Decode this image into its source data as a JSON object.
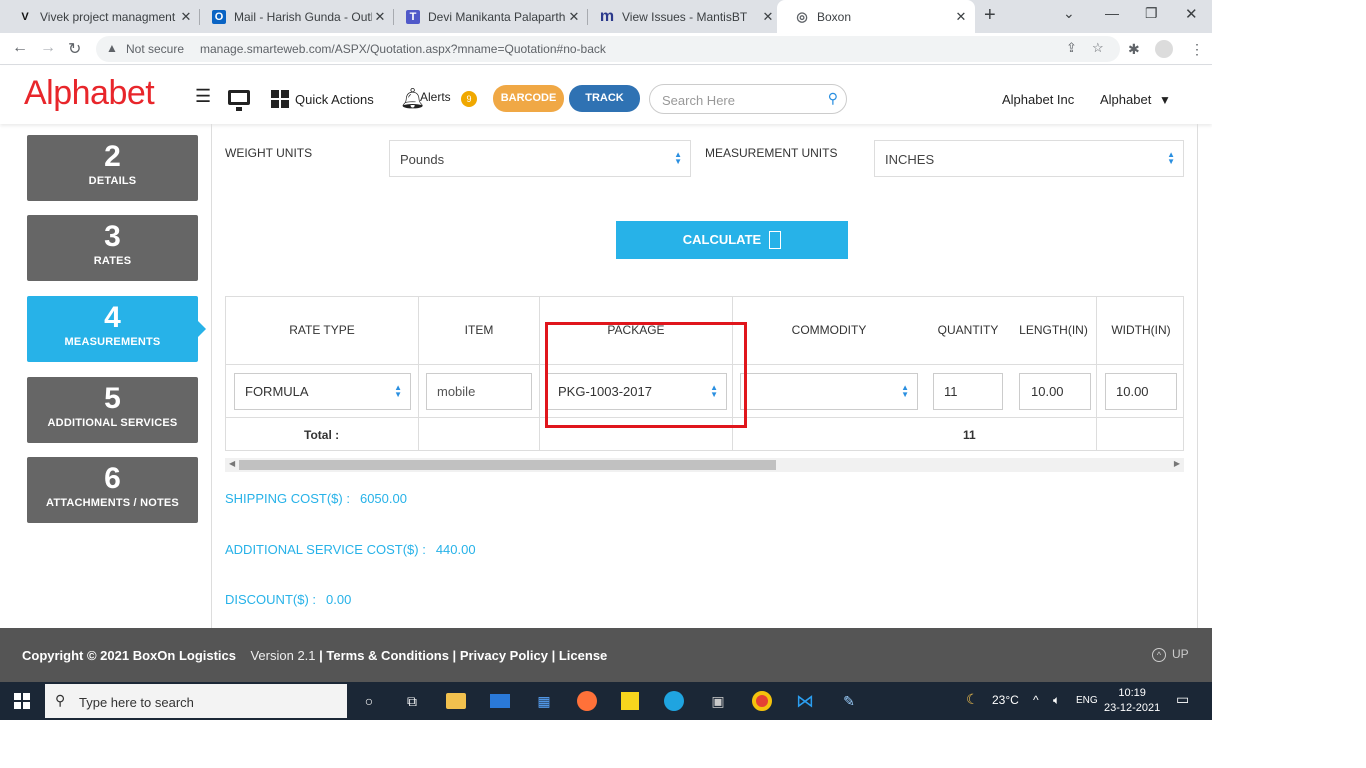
{
  "browser": {
    "tabs": [
      {
        "icon": "V",
        "title": "Vivek project managment",
        "icon_name": "v-favicon-icon"
      },
      {
        "icon": "O",
        "title": "Mail - Harish Gunda - Outlook",
        "icon_name": "outlook-favicon-icon"
      },
      {
        "icon": "T",
        "title": "Devi Manikanta Palaparthi | Microsoft Teams",
        "icon_name": "teams-favicon-icon"
      },
      {
        "icon": "m",
        "title": "View Issues - MantisBT",
        "icon_name": "mantis-favicon-icon"
      },
      {
        "icon": "◎",
        "title": "Boxon",
        "icon_name": "globe-favicon-icon"
      }
    ],
    "new_tab": "+",
    "not_secure": "Not secure",
    "url": "manage.smarteweb.com/ASPX/Quotation.aspx?mname=Quotation#no-back"
  },
  "header": {
    "logo": "Alphabet",
    "quick_actions": "Quick Actions",
    "alerts": "Alerts",
    "alerts_count": "9",
    "barcode": "BARCODE",
    "track": "TRACK",
    "search_placeholder": "Search Here",
    "company": "Alphabet Inc",
    "user": "Alphabet"
  },
  "steps": [
    {
      "num": "2",
      "label": "DETAILS"
    },
    {
      "num": "3",
      "label": "RATES"
    },
    {
      "num": "4",
      "label": "MEASUREMENTS"
    },
    {
      "num": "5",
      "label": "ADDITIONAL SERVICES"
    },
    {
      "num": "6",
      "label": "ATTACHMENTS / NOTES"
    }
  ],
  "form": {
    "weight_units_label": "WEIGHT UNITS",
    "weight_units_value": "Pounds",
    "measurement_units_label": "MEASUREMENT UNITS",
    "measurement_units_value": "INCHES",
    "calculate": "CALCULATE"
  },
  "grid": {
    "headers": [
      "RATE TYPE",
      "ITEM",
      "PACKAGE",
      "COMMODITY",
      "QUANTITY",
      "LENGTH(IN)",
      "WIDTH(IN)"
    ],
    "row": {
      "rate_type": "FORMULA",
      "item": "mobile",
      "package": "PKG-1003-2017",
      "commodity": "",
      "quantity": "11",
      "length": "10.00",
      "width": "10.00"
    },
    "total_label": "Total :",
    "total_quantity": "11"
  },
  "costs": {
    "shipping_label": "SHIPPING COST($) :",
    "shipping_value": "6050.00",
    "additional_label": "ADDITIONAL SERVICE COST($) :",
    "additional_value": "440.00",
    "discount_label": "DISCOUNT($) :",
    "discount_value": "0.00"
  },
  "footer": {
    "copyright": "Copyright © 2021 BoxOn Logistics",
    "version": "Version 2.1",
    "terms": "Terms & Conditions",
    "privacy": "Privacy Policy",
    "license": "License",
    "up": "UP"
  },
  "taskbar": {
    "search_placeholder": "Type here to search",
    "temperature": "23°C",
    "language": "ENG",
    "time": "10:19",
    "date": "23-12-2021"
  },
  "colors": {
    "accent": "#27b2e8",
    "logo_red": "#e8262b",
    "barcode": "#f0a845",
    "track": "#2f72b3",
    "highlight_box": "#e0161c"
  }
}
